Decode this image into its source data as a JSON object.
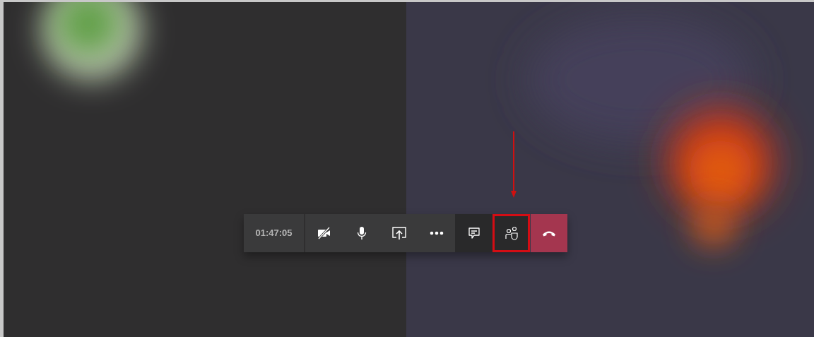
{
  "call": {
    "timer": "01:47:05",
    "controls": [
      {
        "kind": "camera-off",
        "highlighted": false
      },
      {
        "kind": "mic",
        "highlighted": false
      },
      {
        "kind": "share",
        "highlighted": false
      },
      {
        "kind": "more",
        "highlighted": false
      },
      {
        "kind": "chat",
        "highlighted": false
      },
      {
        "kind": "people",
        "highlighted": true
      },
      {
        "kind": "hangup",
        "highlighted": false
      }
    ]
  }
}
